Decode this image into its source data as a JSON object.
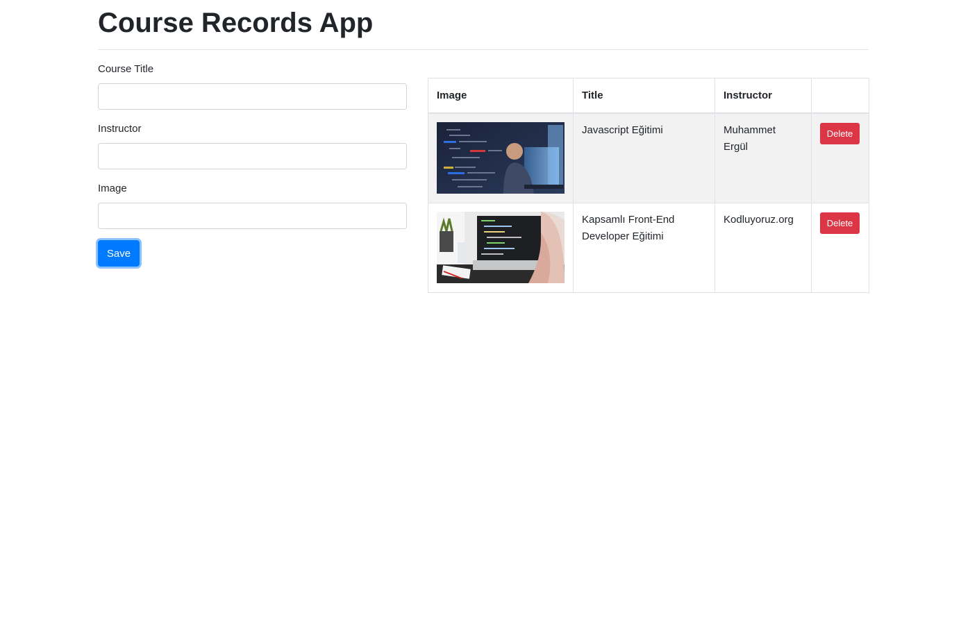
{
  "page": {
    "title": "Course Records App"
  },
  "form": {
    "course_title_label": "Course Title",
    "course_title_value": "",
    "instructor_label": "Instructor",
    "instructor_value": "",
    "image_label": "Image",
    "image_value": "",
    "save_label": "Save"
  },
  "table": {
    "headers": [
      "Image",
      "Title",
      "Instructor",
      ""
    ],
    "rows": [
      {
        "image": "coding-developer-photo",
        "title": "Javascript Eğitimi",
        "instructor": "Muhammet Ergül",
        "action_label": "Delete"
      },
      {
        "image": "laptop-code-photo",
        "title": "Kapsamlı Front-End Developer Eğitimi",
        "instructor": "Kodluyoruz.org",
        "action_label": "Delete"
      }
    ]
  },
  "colors": {
    "primary": "#007bff",
    "danger": "#dc3545",
    "striped_row": "#f2f2f2",
    "border": "#dee2e6"
  }
}
